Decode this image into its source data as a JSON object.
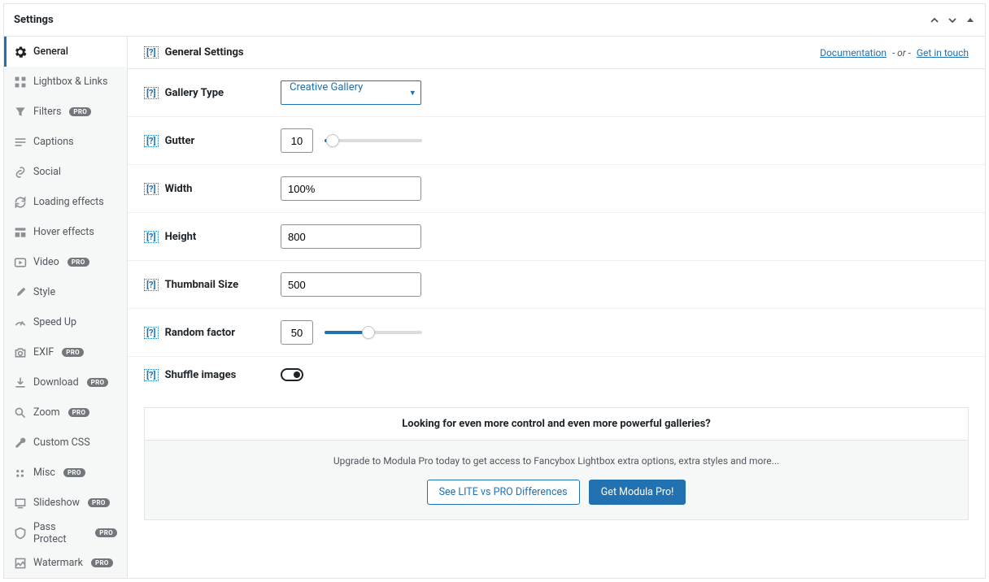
{
  "header": {
    "title": "Settings"
  },
  "sidebar": {
    "items": [
      {
        "label": "General",
        "pro": false
      },
      {
        "label": "Lightbox & Links",
        "pro": false
      },
      {
        "label": "Filters",
        "pro": true
      },
      {
        "label": "Captions",
        "pro": false
      },
      {
        "label": "Social",
        "pro": false
      },
      {
        "label": "Loading effects",
        "pro": false
      },
      {
        "label": "Hover effects",
        "pro": false
      },
      {
        "label": "Video",
        "pro": true
      },
      {
        "label": "Style",
        "pro": false
      },
      {
        "label": "Speed Up",
        "pro": false
      },
      {
        "label": "EXIF",
        "pro": true
      },
      {
        "label": "Download",
        "pro": true
      },
      {
        "label": "Zoom",
        "pro": true
      },
      {
        "label": "Custom CSS",
        "pro": false
      },
      {
        "label": "Misc",
        "pro": true
      },
      {
        "label": "Slideshow",
        "pro": true
      },
      {
        "label": "Pass Protect",
        "pro": true
      },
      {
        "label": "Watermark",
        "pro": true
      }
    ],
    "pro_label": "PRO"
  },
  "content": {
    "header": {
      "title": "General Settings",
      "doc_link": "Documentation",
      "or": "- or -",
      "touch_link": "Get in touch"
    },
    "fields": {
      "gallery_type": {
        "label": "Gallery Type",
        "value": "Creative Gallery"
      },
      "gutter": {
        "label": "Gutter",
        "value": "10",
        "slider_pct": 8
      },
      "width": {
        "label": "Width",
        "value": "100%"
      },
      "height": {
        "label": "Height",
        "value": "800"
      },
      "thumbnail_size": {
        "label": "Thumbnail Size",
        "value": "500"
      },
      "random_factor": {
        "label": "Random factor",
        "value": "50",
        "slider_pct": 45
      },
      "shuffle": {
        "label": "Shuffle images",
        "value": false
      }
    },
    "upsell": {
      "title": "Looking for even more control and even more powerful galleries?",
      "text": "Upgrade to Modula Pro today to get access to Fancybox Lightbox extra options, extra styles and more...",
      "btn1": "See LITE vs PRO Differences",
      "btn2": "Get Modula Pro!"
    }
  },
  "help_glyph": "[?]"
}
